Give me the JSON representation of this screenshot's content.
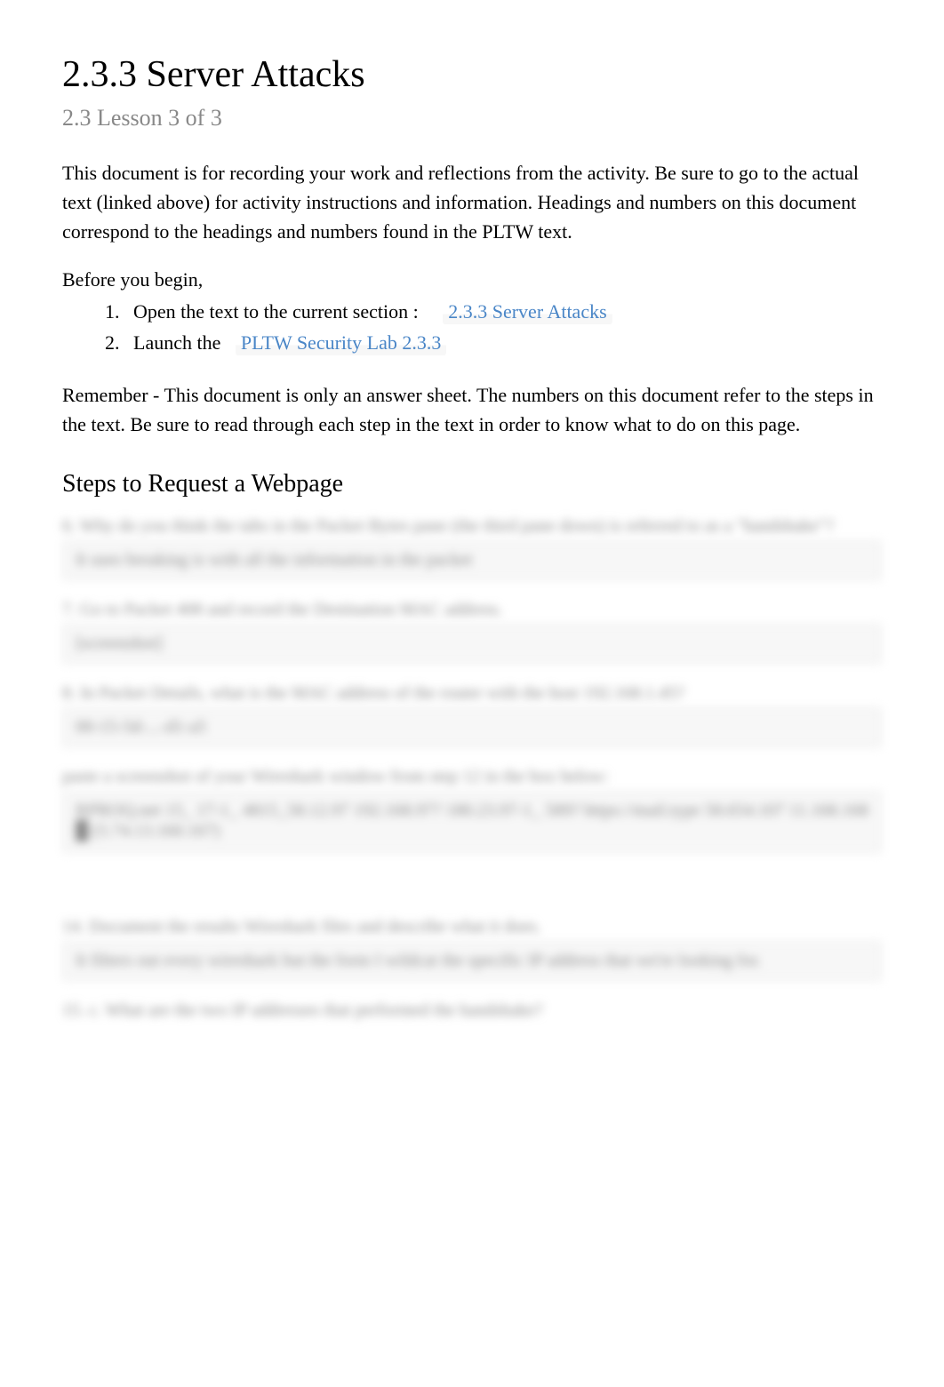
{
  "title": "2.3.3 Server Attacks",
  "subtitle": "2.3 Lesson 3 of 3",
  "intro": "This document is for recording your work and reflections from the activity. Be sure to go to the actual text (linked above) for activity instructions and information. Headings and numbers on this document correspond to the headings and numbers found in the PLTW text.",
  "before_begin": "Before you begin,",
  "list_items": {
    "item1_prefix": "Open the text to the current section :",
    "item1_link": "2.3.3 Server Attacks",
    "item2_prefix": "Launch the",
    "item2_link": "PLTW Security Lab 2.3.3"
  },
  "reminder": "Remember - This document is only an answer sheet. The numbers on this document refer to the steps in the text. Be sure to read through each step in the text in order to know what to do on this page.",
  "section_heading": "Steps to Request a Webpage",
  "qa": {
    "q1": "6. Why do you think the tabs in the Packet Bytes pane (the third pane down) is referred to as a \"handshake\"?",
    "a1": "It uses breaking is with all the information in the packet",
    "q2": "7. Go to Packet 408 and record the Destination MAC address.",
    "a2": "[screenshot]",
    "q3": "8. In Packet Details, what is the MAC address of the router with the host 192.168.1.45?",
    "a3": "00-15-5d-...-d1-a5",
    "q4": "paste a screenshot of your Wireshark window from step 12 in the box below:",
    "a4": "RPROQ.net   15_   17-1_   4815_58.12.97   192.168.97? 180.23.97-1_   589?\n        https://mail.type    58.654.107    11.168.168   █ (5.74.13.160.167)",
    "q5": "14. Document the results Wireshark files and describe what it does.",
    "a5": "It filters out every wireshark but the form I wildcat the specific IP address that we're looking for.",
    "q6": "15. c. What are the two IP addresses that performed the handshake?"
  }
}
